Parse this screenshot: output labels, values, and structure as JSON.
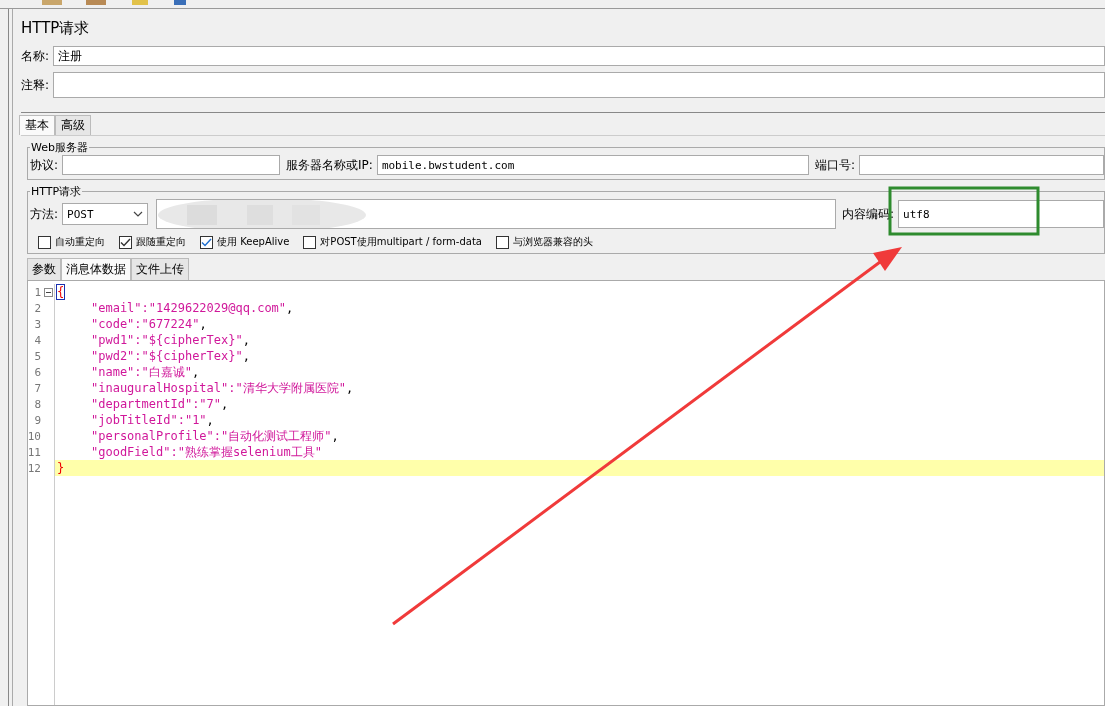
{
  "panel_title": "HTTP请求",
  "name_field": {
    "label": "名称:",
    "value": "注册"
  },
  "comment_field": {
    "label": "注释:"
  },
  "tabs": [
    {
      "label": "基本",
      "selected": true
    },
    {
      "label": "高级",
      "selected": false
    }
  ],
  "web_server": {
    "title": "Web服务器",
    "protocol_label": "协议:",
    "server_label": "服务器名称或IP:",
    "server_value": "mobile.bwstudent.com",
    "port_label": "端口号:"
  },
  "http_request": {
    "title": "HTTP请求",
    "method_label": "方法:",
    "method_value": "POST",
    "encoding_label": "内容编码:",
    "encoding_value": "utf8"
  },
  "options": [
    {
      "label": "自动重定向",
      "checked": false
    },
    {
      "label": "跟随重定向",
      "checked": true
    },
    {
      "label": "使用 KeepAlive",
      "checked": true
    },
    {
      "label": "对POST使用multipart / form-data",
      "checked": false
    },
    {
      "label": "与浏览器兼容的头",
      "checked": false
    }
  ],
  "body_tabs": [
    {
      "label": "参数",
      "selected": false
    },
    {
      "label": "消息体数据",
      "selected": true
    },
    {
      "label": "文件上传",
      "selected": false
    }
  ],
  "editor_lines": [
    {
      "number": "1",
      "kind": "brace",
      "text": "{",
      "highlighted": false
    },
    {
      "number": "2",
      "kind": "pair",
      "text": "\"email\":\"1429622029@qq.com\"",
      "trailing": ",",
      "highlighted": false
    },
    {
      "number": "3",
      "kind": "pair",
      "text": "\"code\":\"677224\"",
      "trailing": ",",
      "highlighted": false
    },
    {
      "number": "4",
      "kind": "pair",
      "text": "\"pwd1\":\"${cipherTex}\"",
      "trailing": ",",
      "highlighted": false
    },
    {
      "number": "5",
      "kind": "pair",
      "text": "\"pwd2\":\"${cipherTex}\"",
      "trailing": ",",
      "highlighted": false
    },
    {
      "number": "6",
      "kind": "pair",
      "text": "\"name\":\"白嘉诚\"",
      "trailing": ",",
      "highlighted": false
    },
    {
      "number": "7",
      "kind": "pair",
      "text": "\"inauguralHospital\":\"清华大学附属医院\"",
      "trailing": ",",
      "highlighted": false
    },
    {
      "number": "8",
      "kind": "pair",
      "text": "\"departmentId\":\"7\"",
      "trailing": ",",
      "highlighted": false
    },
    {
      "number": "9",
      "kind": "pair",
      "text": "\"jobTitleId\":\"1\"",
      "trailing": ",",
      "highlighted": false
    },
    {
      "number": "10",
      "kind": "pair",
      "text": "\"personalProfile\":\"自动化测试工程师\"",
      "trailing": ",",
      "highlighted": false
    },
    {
      "number": "11",
      "kind": "pair",
      "text": "\"goodField\":\"熟练掌握selenium工具\"",
      "highlighted": false
    },
    {
      "number": "12",
      "kind": "brace",
      "text": "}",
      "highlighted": true
    }
  ]
}
